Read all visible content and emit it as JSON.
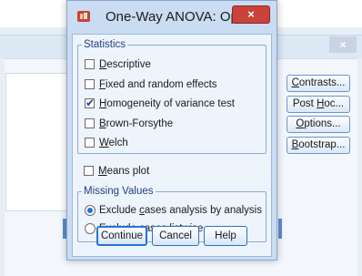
{
  "dialog": {
    "title": "One-Way ANOVA: Options",
    "close_glyph": "×",
    "statistics": {
      "legend": "Statistics",
      "options": [
        {
          "pre": "",
          "mnemonic": "D",
          "post": "escriptive",
          "checked": false
        },
        {
          "pre": "",
          "mnemonic": "F",
          "post": "ixed and random effects",
          "checked": false
        },
        {
          "pre": "",
          "mnemonic": "H",
          "post": "omogeneity of variance test",
          "checked": true
        },
        {
          "pre": "",
          "mnemonic": "B",
          "post": "rown-Forsythe",
          "checked": false
        },
        {
          "pre": "",
          "mnemonic": "W",
          "post": "elch",
          "checked": false
        }
      ]
    },
    "means_plot": {
      "pre": "",
      "mnemonic": "M",
      "post": "eans plot",
      "checked": false
    },
    "missing_values": {
      "legend": "Missing Values",
      "options": [
        {
          "pre": "Exclude ",
          "mnemonic": "c",
          "post": "ases analysis by analysis",
          "selected": true
        },
        {
          "pre": "Exc",
          "mnemonic": "l",
          "post": "ude cases listwise",
          "selected": false
        }
      ]
    },
    "buttons": {
      "continue": "Continue",
      "cancel": "Cancel",
      "help": "Help"
    },
    "check_glyph": "✔"
  },
  "parent_dialog": {
    "close_glyph": "×",
    "buttons": [
      {
        "pre": "",
        "mnemonic": "C",
        "post": "ontrasts..."
      },
      {
        "pre": "Post ",
        "mnemonic": "H",
        "post": "oc..."
      },
      {
        "pre": "",
        "mnemonic": "O",
        "post": "ptions..."
      },
      {
        "pre": "",
        "mnemonic": "B",
        "post": "ootstrap..."
      }
    ]
  },
  "colors": {
    "accent": "#2a74d4",
    "close_button": "#c9433a",
    "dialog_frame": "#c9dcf2",
    "group_label": "#1f3f7a"
  }
}
